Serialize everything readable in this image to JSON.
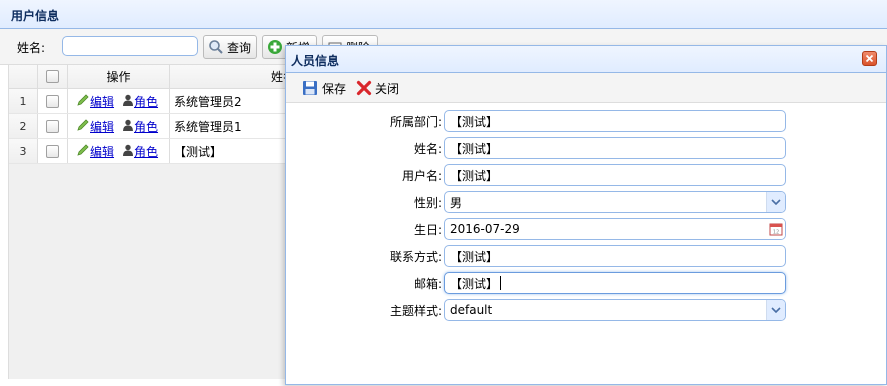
{
  "panel": {
    "title": "用户信息"
  },
  "toolbar": {
    "name_label": "姓名:",
    "name_input_value": "",
    "search_label": "查询",
    "add_label": "新增",
    "delete_label": "删除"
  },
  "grid": {
    "headers": [
      "",
      "",
      "操作",
      "姓名"
    ],
    "rows": [
      {
        "num": "1",
        "edit": "编辑",
        "role": "角色",
        "name": "系统管理员2"
      },
      {
        "num": "2",
        "edit": "编辑",
        "role": "角色",
        "name": "系统管理员1"
      },
      {
        "num": "3",
        "edit": "编辑",
        "role": "角色",
        "name": "【测试】"
      }
    ]
  },
  "dialog": {
    "title": "人员信息",
    "save_label": "保存",
    "close_label": "关闭",
    "fields": [
      {
        "label": "所属部门:",
        "value": "【测试】",
        "type": "text"
      },
      {
        "label": "姓名:",
        "value": "【测试】",
        "type": "text"
      },
      {
        "label": "用户名:",
        "value": "【测试】",
        "type": "text"
      },
      {
        "label": "性别:",
        "value": "男",
        "type": "combo"
      },
      {
        "label": "生日:",
        "value": "2016-07-29",
        "type": "date"
      },
      {
        "label": "联系方式:",
        "value": "【测试】",
        "type": "text"
      },
      {
        "label": "邮箱:",
        "value": "【测试】",
        "type": "text-focus"
      },
      {
        "label": "主题样式:",
        "value": "default",
        "type": "combo"
      }
    ]
  },
  "colors": {
    "accent_border": "#95b8e7",
    "header_title": "#0e2d5f",
    "link": "#0000cc"
  }
}
